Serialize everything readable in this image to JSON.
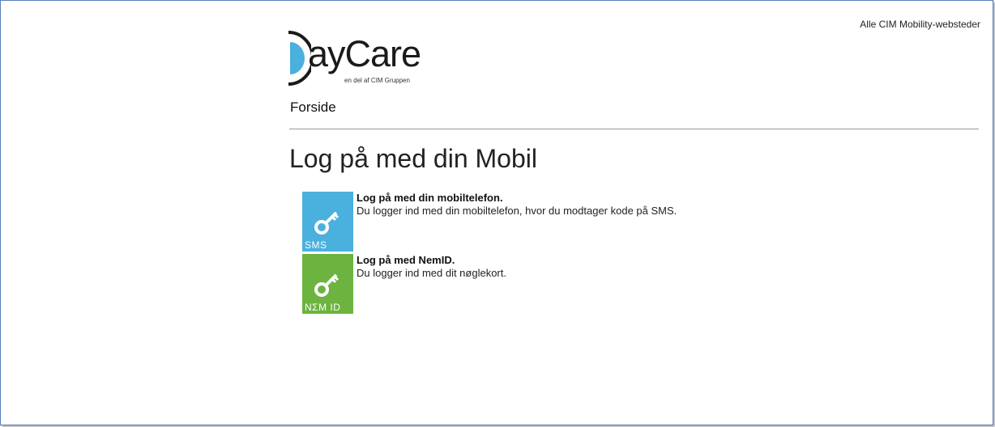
{
  "header": {
    "all_sites_link": "Alle CIM Mobility-websteder"
  },
  "logo": {
    "brand": "ayCare",
    "tagline": "en del af CIM Gruppen",
    "colors": {
      "accent": "#4ab0de",
      "dark": "#1a1a1a"
    }
  },
  "nav": {
    "home_label": "Forside"
  },
  "main": {
    "title": "Log på med din Mobil",
    "options": [
      {
        "tile_label": "SMS",
        "tile_color": "#4ab0de",
        "icon": "key-icon",
        "title": "Log på med din mobiltelefon.",
        "description": "Du logger ind med din mobiltelefon, hvor du modtager kode på SMS."
      },
      {
        "tile_label": "NΣM ID",
        "tile_color": "#6cb33f",
        "icon": "key-icon",
        "title": "Log på med NemID.",
        "description": "Du logger ind med dit nøglekort."
      }
    ]
  }
}
